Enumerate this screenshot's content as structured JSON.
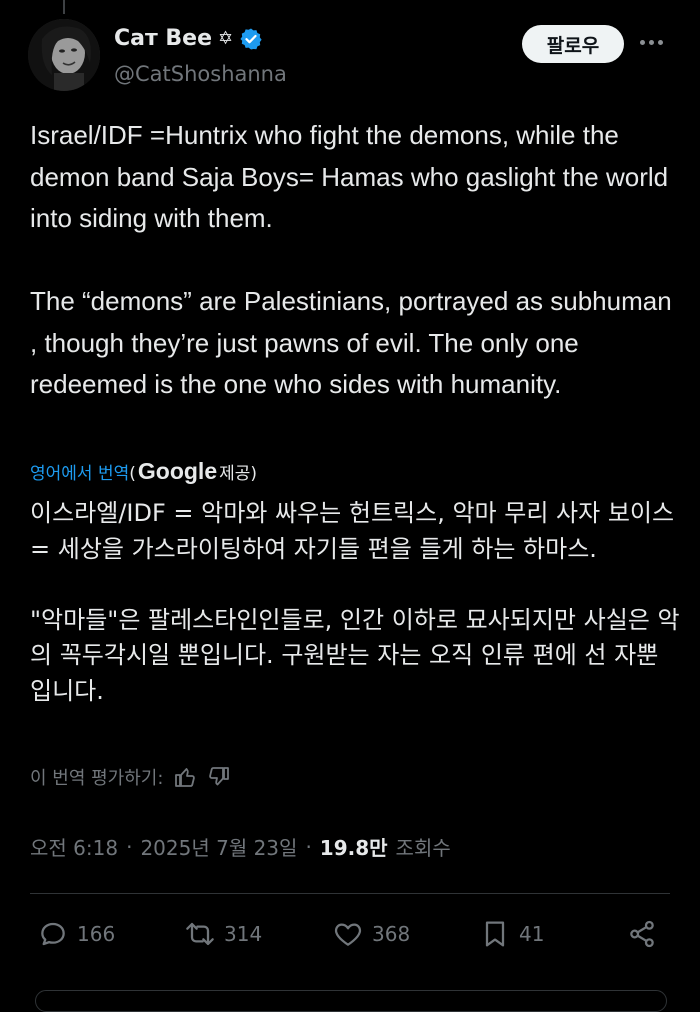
{
  "author": {
    "display_name": "Cат Bee",
    "star_symbol": "✡",
    "handle": "@CatShoshanna",
    "verified_color": "#1d9bf0"
  },
  "follow_label": "팔로우",
  "tweet_text": "Israel/IDF =Huntrix who fight the demons, while the demon band Saja Boys= Hamas who gaslight the world into siding with them.\n\nThe “demons” are Palestinians, portrayed as subhuman , though they’re just pawns of evil. The only one redeemed is the one who sides with humanity.",
  "translation": {
    "link": "영어에서 번역",
    "open_paren": "(",
    "google": "Google",
    "provided": "제공)",
    "text": "이스라엘/IDF = 악마와 싸우는 헌트릭스, 악마 무리 사자 보이스 = 세상을 가스라이팅하여 자기들 편을 들게 하는 하마스.\n\n\"악마들\"은 팔레스타인인들로, 인간 이하로 묘사되지만 사실은 악의 꼭두각시일 뿐입니다. 구원받는 자는 오직 인류 편에 선 자뿐입니다.",
    "rate_label": "이 번역 평가하기:"
  },
  "meta": {
    "time": "오전 6:18",
    "sep": "·",
    "date": "2025년 7월 23일",
    "views": "19.8만",
    "views_label": "조회수"
  },
  "actions": {
    "replies": "166",
    "retweets": "314",
    "likes": "368",
    "bookmarks": "41"
  },
  "colors": {
    "background": "#000000",
    "text": "#e7e9ea",
    "secondary": "#71767b",
    "link": "#1d9bf0"
  }
}
